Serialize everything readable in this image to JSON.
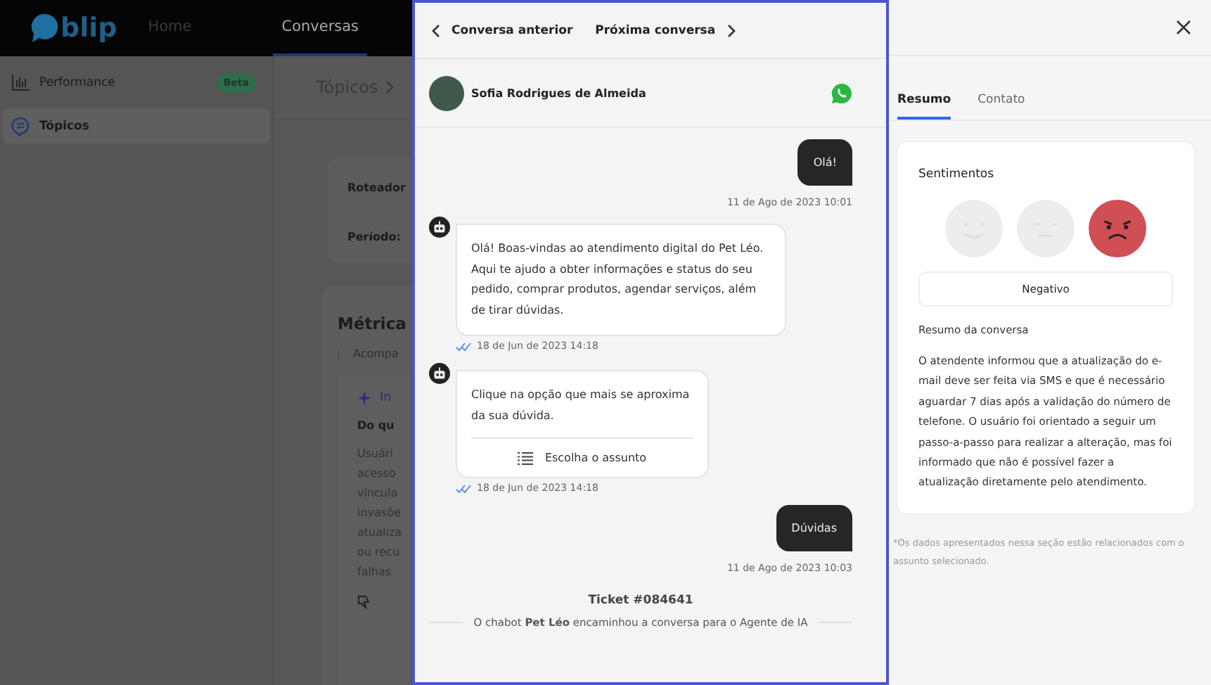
{
  "topbar": {
    "logo": "blip",
    "nav": [
      {
        "label": "Home",
        "selected": false
      },
      {
        "label": "Conversas",
        "selected": true
      }
    ]
  },
  "sidebar": {
    "items": [
      {
        "label": "Performance",
        "kind": "chart",
        "badge": "Beta",
        "selected": false
      },
      {
        "label": "Tópicos",
        "kind": "topics",
        "selected": true
      }
    ]
  },
  "main": {
    "breadcrumb": "Tópicos",
    "filters": [
      "Roteador",
      "Período:"
    ],
    "section_title": "Métrica",
    "section_tab": "Acompa",
    "insight_label": "In",
    "insight_title": "Do qu",
    "insight_lines": [
      "Usuári",
      "acesso",
      "vincula",
      "invasõe",
      "atualiza",
      "ou recu",
      "falhas"
    ]
  },
  "chat": {
    "prev": "Conversa anterior",
    "next": "Próxima conversa",
    "contact": "Sofia Rodrigues de Almeida",
    "messages": [
      {
        "kind": "user",
        "text": "Olá!",
        "time": "11 de Ago de 2023 10:01"
      },
      {
        "kind": "bot",
        "text": "Olá! Boas-vindas ao atendimento digital do Pet Léo. Aqui te ajudo a obter informações e status do seu pedido, comprar produtos, agendar serviços, além de tirar dúvidas.",
        "time": "18 de Jun de 2023 14:18"
      },
      {
        "kind": "bot",
        "text": "Clique na opção que mais se aproxima da sua dúvida.",
        "action": "Escolha o assunto",
        "time": "18 de Jun de 2023 14:18"
      },
      {
        "kind": "user",
        "text": "Dúvidas",
        "time": "11 de Ago de 2023 10:03"
      }
    ],
    "ticket": "Ticket #084641",
    "event": "O chabot **Pet Léo** encaminhou a conversa para o Agente de IA"
  },
  "details": {
    "tabs": [
      {
        "label": "Resumo",
        "selected": true
      },
      {
        "label": "Contato",
        "selected": false
      }
    ],
    "sentiment_title": "Sentimentos",
    "sentiments": [
      {
        "kind": "positive",
        "selected": false
      },
      {
        "kind": "neutral",
        "selected": false
      },
      {
        "kind": "negative",
        "selected": true
      }
    ],
    "sentiment_label": "Negativo",
    "summary_title": "Resumo da conversa",
    "summary": "O atendente informou que a atualização do e-mail deve ser feita via SMS e que é necessário aguardar 7 dias após a validação do número de telefone. O usuário foi orientado a seguir um passo-a-passo para realizar a alteração, mas foi informado que não é possível fazer a atualização diretamente pelo atendimento.",
    "footnote": "*Os dados apresentados nessa seção estão relacionados com o assunto selecionado."
  }
}
